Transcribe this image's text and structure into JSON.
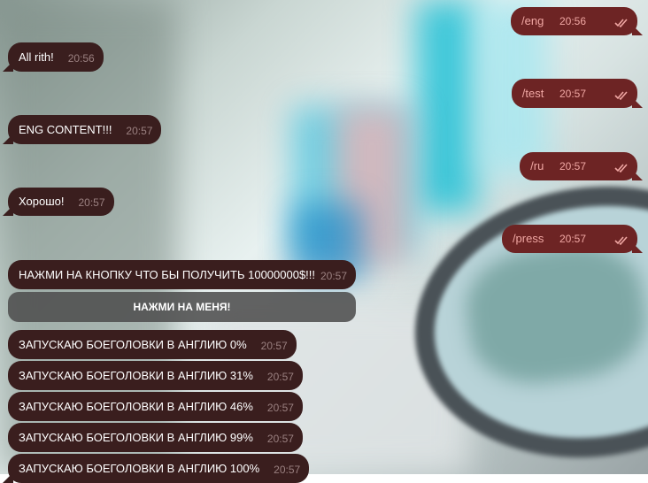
{
  "chat": {
    "messages": [
      {
        "id": "m1",
        "side": "out",
        "text": "/eng",
        "time": "20:56"
      },
      {
        "id": "m2",
        "side": "in",
        "text": "All rith!",
        "time": "20:56"
      },
      {
        "id": "m3",
        "side": "out",
        "text": "/test",
        "time": "20:57"
      },
      {
        "id": "m4",
        "side": "in",
        "text": "ENG CONTENT!!!",
        "time": "20:57"
      },
      {
        "id": "m5",
        "side": "out",
        "text": "/ru",
        "time": "20:57"
      },
      {
        "id": "m6",
        "side": "in",
        "text": "Хорошо!",
        "time": "20:57"
      },
      {
        "id": "m7",
        "side": "out",
        "text": "/press",
        "time": "20:57"
      },
      {
        "id": "m8",
        "side": "in",
        "text": "НАЖМИ НА КНОПКУ ЧТО БЫ ПОЛУЧИТЬ 10000000$!!!",
        "time": "20:57"
      },
      {
        "id": "m9",
        "side": "in",
        "text": "ЗАПУСКАЮ БОЕГОЛОВКИ В АНГЛИЮ 0%",
        "time": "20:57"
      },
      {
        "id": "m10",
        "side": "in",
        "text": "ЗАПУСКАЮ БОЕГОЛОВКИ В АНГЛИЮ 31%",
        "time": "20:57"
      },
      {
        "id": "m11",
        "side": "in",
        "text": "ЗАПУСКАЮ БОЕГОЛОВКИ В АНГЛИЮ 46%",
        "time": "20:57"
      },
      {
        "id": "m12",
        "side": "in",
        "text": "ЗАПУСКАЮ БОЕГОЛОВКИ В АНГЛИЮ 99%",
        "time": "20:57"
      },
      {
        "id": "m13",
        "side": "in",
        "text": "ЗАПУСКАЮ БОЕГОЛОВКИ В АНГЛИЮ 100%",
        "time": "20:57"
      }
    ],
    "inline_button_label": "НАЖМИ НА МЕНЯ!",
    "read_status_icon": "double-check-icon"
  },
  "colors": {
    "incoming_bubble": "#3a1e1e",
    "outgoing_bubble": "#6d2424",
    "outgoing_text": "#f0a7a3",
    "inline_button": "#4e4e4e"
  }
}
